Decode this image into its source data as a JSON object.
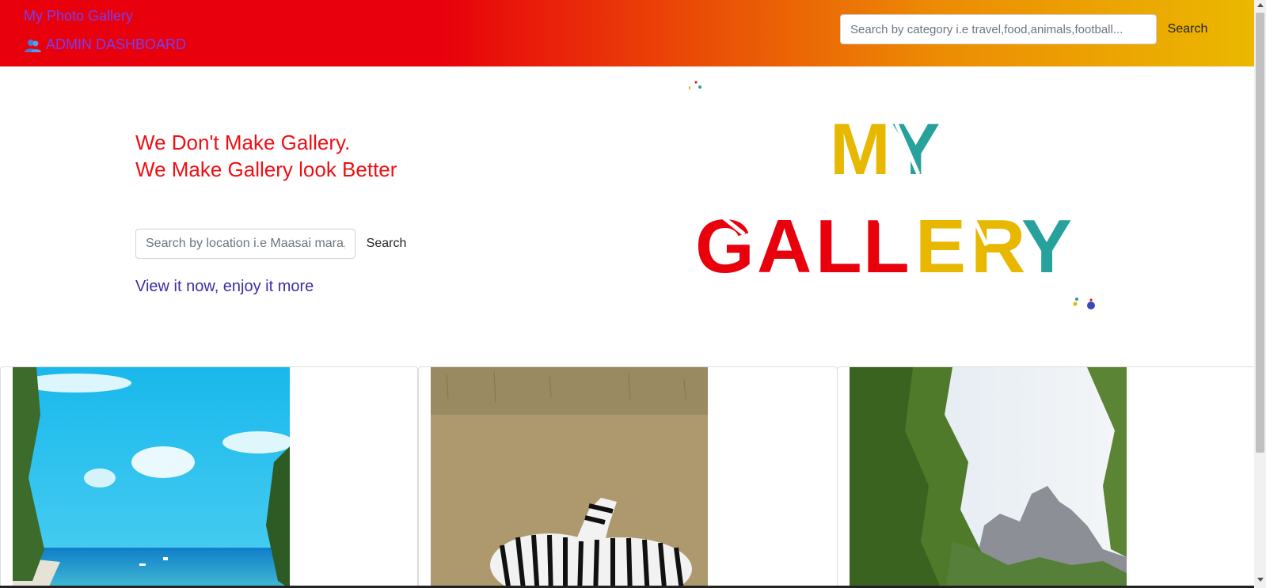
{
  "navbar": {
    "brand": "My Photo Gallery",
    "admin_link": "ADMIN DASHBOARD",
    "search_placeholder": "Search by category i.e travel,food,animals,football...",
    "search_button": "Search"
  },
  "hero": {
    "line1": "We Don't Make Gallery.",
    "line2": "We Make Gallery look Better",
    "location_search_placeholder": "Search by location i.e Maasai mara,",
    "location_search_button": "Search",
    "tagline": "View it now, enjoy it more"
  },
  "logo": {
    "word1": "MY",
    "word2": "GALLERY"
  },
  "gallery": {
    "photos": [
      {
        "subject": "beach"
      },
      {
        "subject": "zebras"
      },
      {
        "subject": "forest-mountains"
      }
    ]
  },
  "colors": {
    "nav_red": "#e8000c",
    "nav_yellow": "#ebb800",
    "hero_text": "#ee0f14",
    "link": "#7a3df0",
    "logo_red": "#e8000c",
    "logo_yellow": "#e8b800",
    "logo_teal": "#26a19b"
  }
}
